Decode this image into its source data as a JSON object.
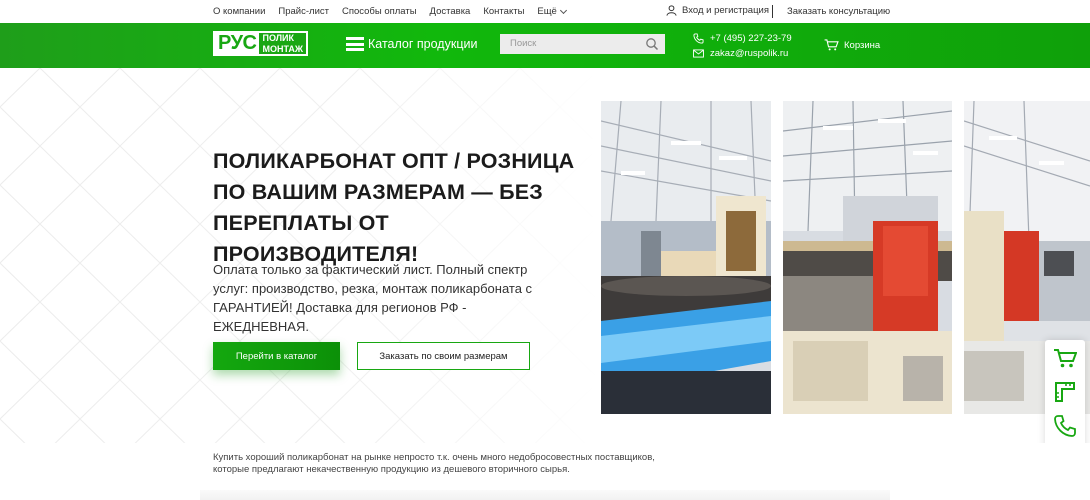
{
  "topbar": {
    "nav": [
      "О компании",
      "Прайс-лист",
      "Способы оплаты",
      "Доставка",
      "Контакты"
    ],
    "more": "Ещё",
    "login": "Вход и регистрация",
    "consult": "Заказать консультацию"
  },
  "header": {
    "logo_main": "РУС",
    "logo_top": "ПОЛИК",
    "logo_bottom": "МОНТАЖ",
    "catalog": "Каталог продукции",
    "search_placeholder": "Поиск",
    "phone": "+7 (495) 227-23-79",
    "email": "zakaz@ruspolik.ru",
    "cart": "Корзина"
  },
  "hero": {
    "title": "ПОЛИКАРБОНАТ ОПТ / РОЗНИЦА ПО ВАШИМ РАЗМЕРАМ — БЕЗ ПЕРЕПЛАТЫ ОТ ПРОИЗВОДИТЕЛЯ!",
    "text": "Оплата только за фактический лист. Полный спектр услуг: производство, резка, монтаж поликарбоната с ГАРАНТИЕЙ! Доставка для регионов РФ - ЕЖЕДНЕВНАЯ.",
    "btn_catalog": "Перейти в каталог",
    "btn_order": "Заказать по своим размерам"
  },
  "footer_text": "Купить хороший поликарбонат на рынке непросто т.к. очень много недобросовестных поставщиков, которые предлагают некачественную продукцию из дешевого вторичного сырья.",
  "colors": {
    "brand_green": "#13a90e"
  },
  "icons": [
    "user-icon",
    "search-icon",
    "phone-icon",
    "mail-icon",
    "cart-icon",
    "burger-icon"
  ]
}
